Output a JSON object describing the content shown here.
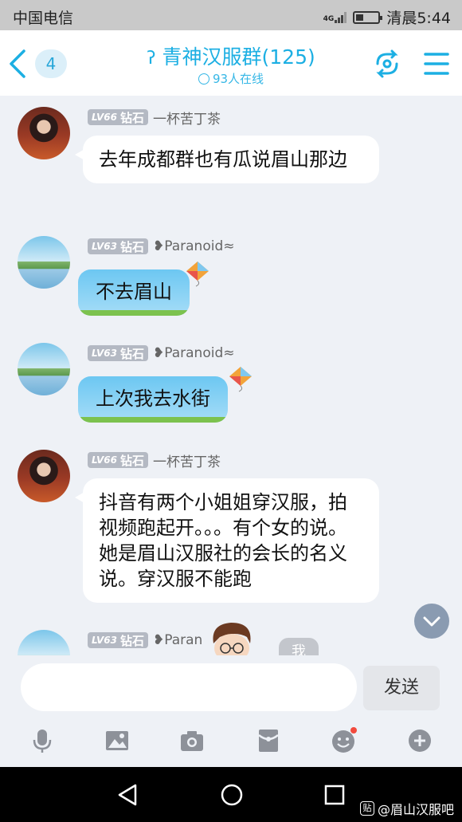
{
  "status_bar": {
    "carrier": "中国电信",
    "network": "4G",
    "time": "清晨5:44",
    "battery_level": 0.35
  },
  "header": {
    "unread_count": "4",
    "group_title": "青神汉服群(125)",
    "online_text": "93人在线",
    "accent_color": "#1cafe3"
  },
  "messages": [
    {
      "level": "LV66",
      "rank": "钻石",
      "sender": "一杯苦丁茶",
      "text": "去年成都群也有瓜说眉山那边",
      "avatar": "woman-portrait",
      "style": "plain"
    },
    {
      "level": "LV63",
      "rank": "钻石",
      "sender": "❥Paranoid≈",
      "text": "不去眉山",
      "avatar": "landscape",
      "style": "kite-bubble"
    },
    {
      "level": "LV63",
      "rank": "钻石",
      "sender": "❥Paranoid≈",
      "text": "上次我去水街",
      "avatar": "landscape",
      "style": "kite-bubble"
    },
    {
      "level": "LV66",
      "rank": "钻石",
      "sender": "一杯苦丁茶",
      "text": "抖音有两个小姐姐穿汉服，拍视频跑起开。。。有个女的说。她是眉山汉服社的会长的名义说。穿汉服不能跑",
      "avatar": "woman-portrait",
      "style": "plain"
    },
    {
      "level": "LV63",
      "rank": "钻石",
      "sender": "❥Paran",
      "text": "",
      "avatar": "landscape",
      "style": "kite-bubble"
    }
  ],
  "overlay": {
    "me_label": "我"
  },
  "input": {
    "value": "",
    "send_label": "发送"
  },
  "toolbar": {
    "icons": [
      "mic-icon",
      "image-icon",
      "camera-icon",
      "red-packet-icon",
      "emoji-icon",
      "plus-icon"
    ]
  },
  "navbar": {
    "watermark": "@眉山汉服吧",
    "watermark_logo": "贴"
  }
}
